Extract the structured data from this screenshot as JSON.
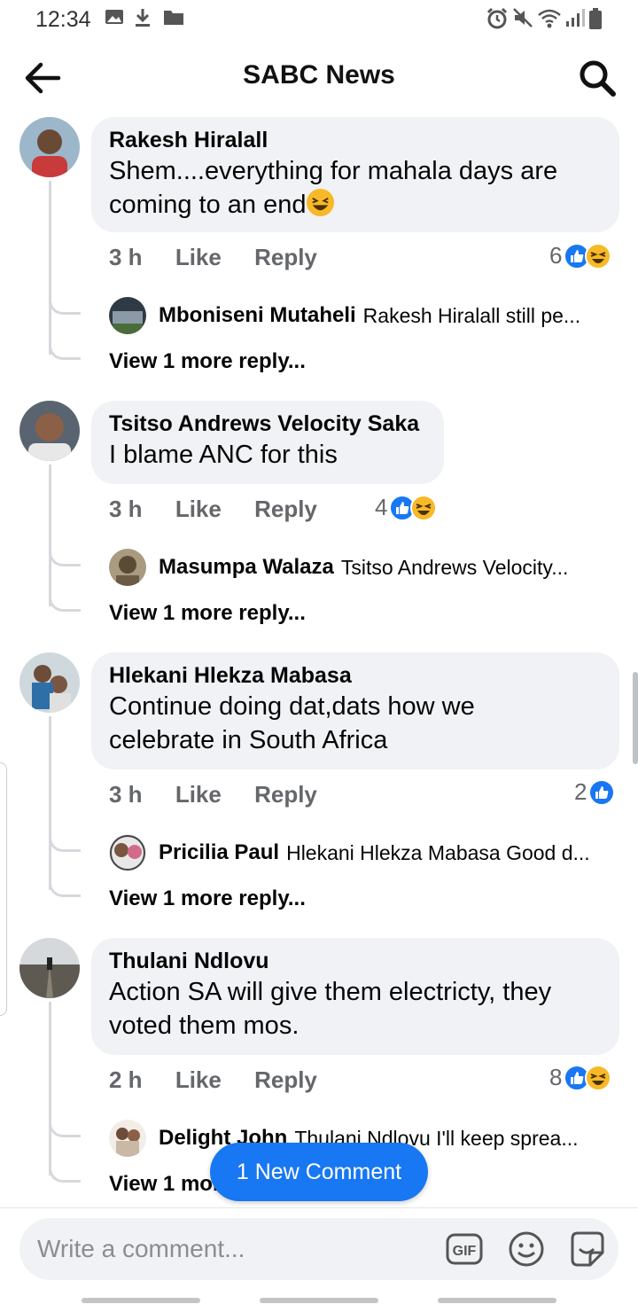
{
  "status_bar": {
    "time": "12:34",
    "left_icons": [
      "image-icon",
      "download-icon",
      "folder-icon"
    ],
    "right_icons": [
      "alarm-icon",
      "mute-icon",
      "wifi-icon",
      "signal-icon",
      "battery-icon"
    ]
  },
  "header": {
    "title": "SABC News",
    "back_icon": "back-arrow-icon",
    "search_icon": "search-icon"
  },
  "comments": [
    {
      "author": "Rakesh Hiralall",
      "text_line1": "Shem....everything for mahala days are",
      "text_line2": "coming to an end",
      "emoji": "laughing-emoji",
      "time": "3 h",
      "like_label": "Like",
      "reply_label": "Reply",
      "reaction_count": "6",
      "reactions": [
        "like-reaction",
        "haha-reaction"
      ],
      "reply_author": "Mboniseni Mutaheli",
      "reply_preview": "Rakesh Hiralall still pe...",
      "view_more": "View 1 more reply..."
    },
    {
      "author": "Tsitso Andrews Velocity Saka",
      "text_line1": "I blame ANC for this",
      "time": "3 h",
      "like_label": "Like",
      "reply_label": "Reply",
      "reaction_count": "4",
      "reactions": [
        "like-reaction",
        "haha-reaction"
      ],
      "reply_author": "Masumpa Walaza",
      "reply_preview": "Tsitso Andrews Velocity...",
      "view_more": "View 1 more reply..."
    },
    {
      "author": "Hlekani Hlekza Mabasa",
      "text_line1": "Continue doing dat,dats how we",
      "text_line2": "celebrate in South Africa",
      "time": "3 h",
      "like_label": "Like",
      "reply_label": "Reply",
      "reaction_count": "2",
      "reactions": [
        "like-reaction"
      ],
      "reply_author": "Pricilia Paul",
      "reply_preview": "Hlekani Hlekza Mabasa Good d...",
      "view_more": "View 1 more reply..."
    },
    {
      "author": "Thulani Ndlovu",
      "text_line1": "Action SA will give them electricty, they",
      "text_line2": "voted them mos.",
      "time": "2 h",
      "like_label": "Like",
      "reply_label": "Reply",
      "reaction_count": "8",
      "reactions": [
        "like-reaction",
        "haha-reaction"
      ],
      "reply_author": "Delight John",
      "reply_preview": "Thulani Ndlovu  I'll keep sprea...",
      "view_more": "View 1 more reply..."
    }
  ],
  "new_comment_pill": "1 New Comment",
  "composer": {
    "placeholder": "Write a comment...",
    "icons": [
      "gif-icon",
      "emoji-icon",
      "sticker-icon"
    ]
  },
  "colors": {
    "accent": "#1877f2",
    "bubble": "#f0f2f5",
    "meta_text": "#65676b"
  }
}
